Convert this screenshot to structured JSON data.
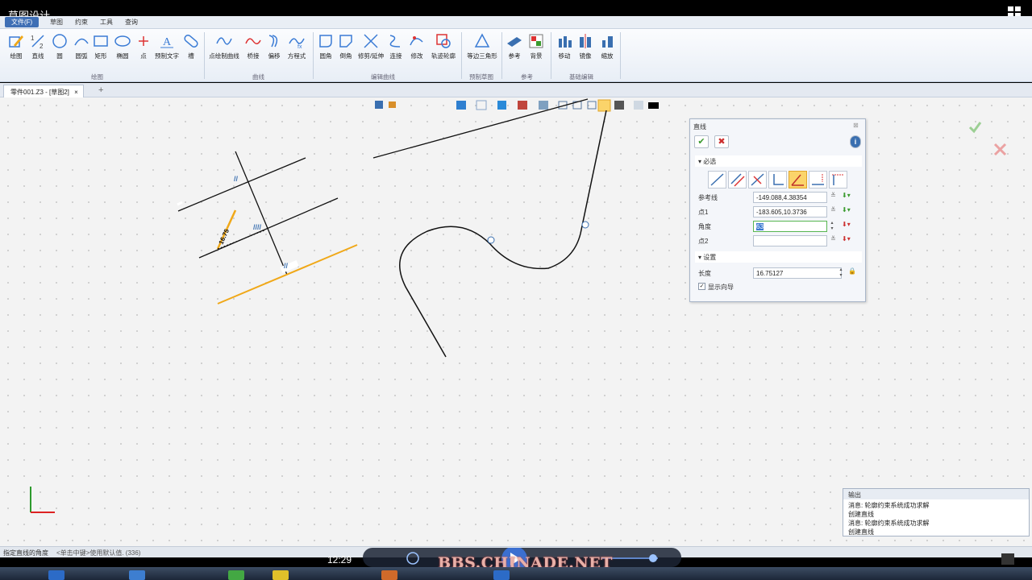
{
  "window": {
    "title": "草图设计"
  },
  "menu": {
    "file_tab": "文件(F)",
    "tabs": [
      "草图",
      "约束",
      "工具",
      "查询"
    ]
  },
  "ribbon": {
    "buttons": [
      "绘图",
      "直线",
      "圆",
      "圆弧",
      "矩形",
      "椭圆",
      "点",
      "预制文字",
      "槽",
      "点绘制曲线",
      "桥接",
      "偏移",
      "方程式",
      "圆角",
      "倒角",
      "修剪/延伸",
      "连接",
      "修改",
      "轨迹轮廓",
      "等边三角形",
      "参考",
      "背景",
      "移动",
      "镜像",
      "缩放"
    ],
    "groups": [
      "绘图",
      "曲线",
      "编辑曲线",
      "预制草图",
      "参考",
      "基础编辑"
    ]
  },
  "doc_tab": {
    "label": "零件001.Z3 - [草图2]",
    "close": "×",
    "add": "+"
  },
  "sketch": {
    "dimension_value": "16.75",
    "constraint_marks": [
      "//",
      "////",
      "//"
    ]
  },
  "panel": {
    "title": "直线",
    "close": "⊠",
    "ok": "✔",
    "cancel": "✖",
    "info": "i",
    "required_section": "必选",
    "settings_section": "设置",
    "fields": [
      {
        "label": "参考线",
        "value": "-149.088,4.38354"
      },
      {
        "label": "点1",
        "value": "-183.605,10.3736"
      },
      {
        "label": "角度",
        "value": "63"
      },
      {
        "label": "点2",
        "value": ""
      }
    ],
    "length_label": "长度",
    "length_value": "16.75127",
    "show_guide": "显示向导",
    "show_guide_checked": true
  },
  "output": {
    "title": "输出",
    "lines": [
      "消息: 轮廓约束系统成功求解",
      "创建直线",
      "消息: 轮廓约束系统成功求解",
      "创建直线"
    ]
  },
  "status": {
    "text": "指定直线的角度",
    "hint": "<单击中键>使用默认值. (336)"
  },
  "player": {
    "time": "12:29",
    "watermark": "BBS.CHINADE.NET"
  },
  "colors": {
    "accent": "#f0a818",
    "ok_green": "#3a9a2e",
    "cancel_red": "#cc2f2f",
    "file_tab": "#3f6fb5"
  }
}
